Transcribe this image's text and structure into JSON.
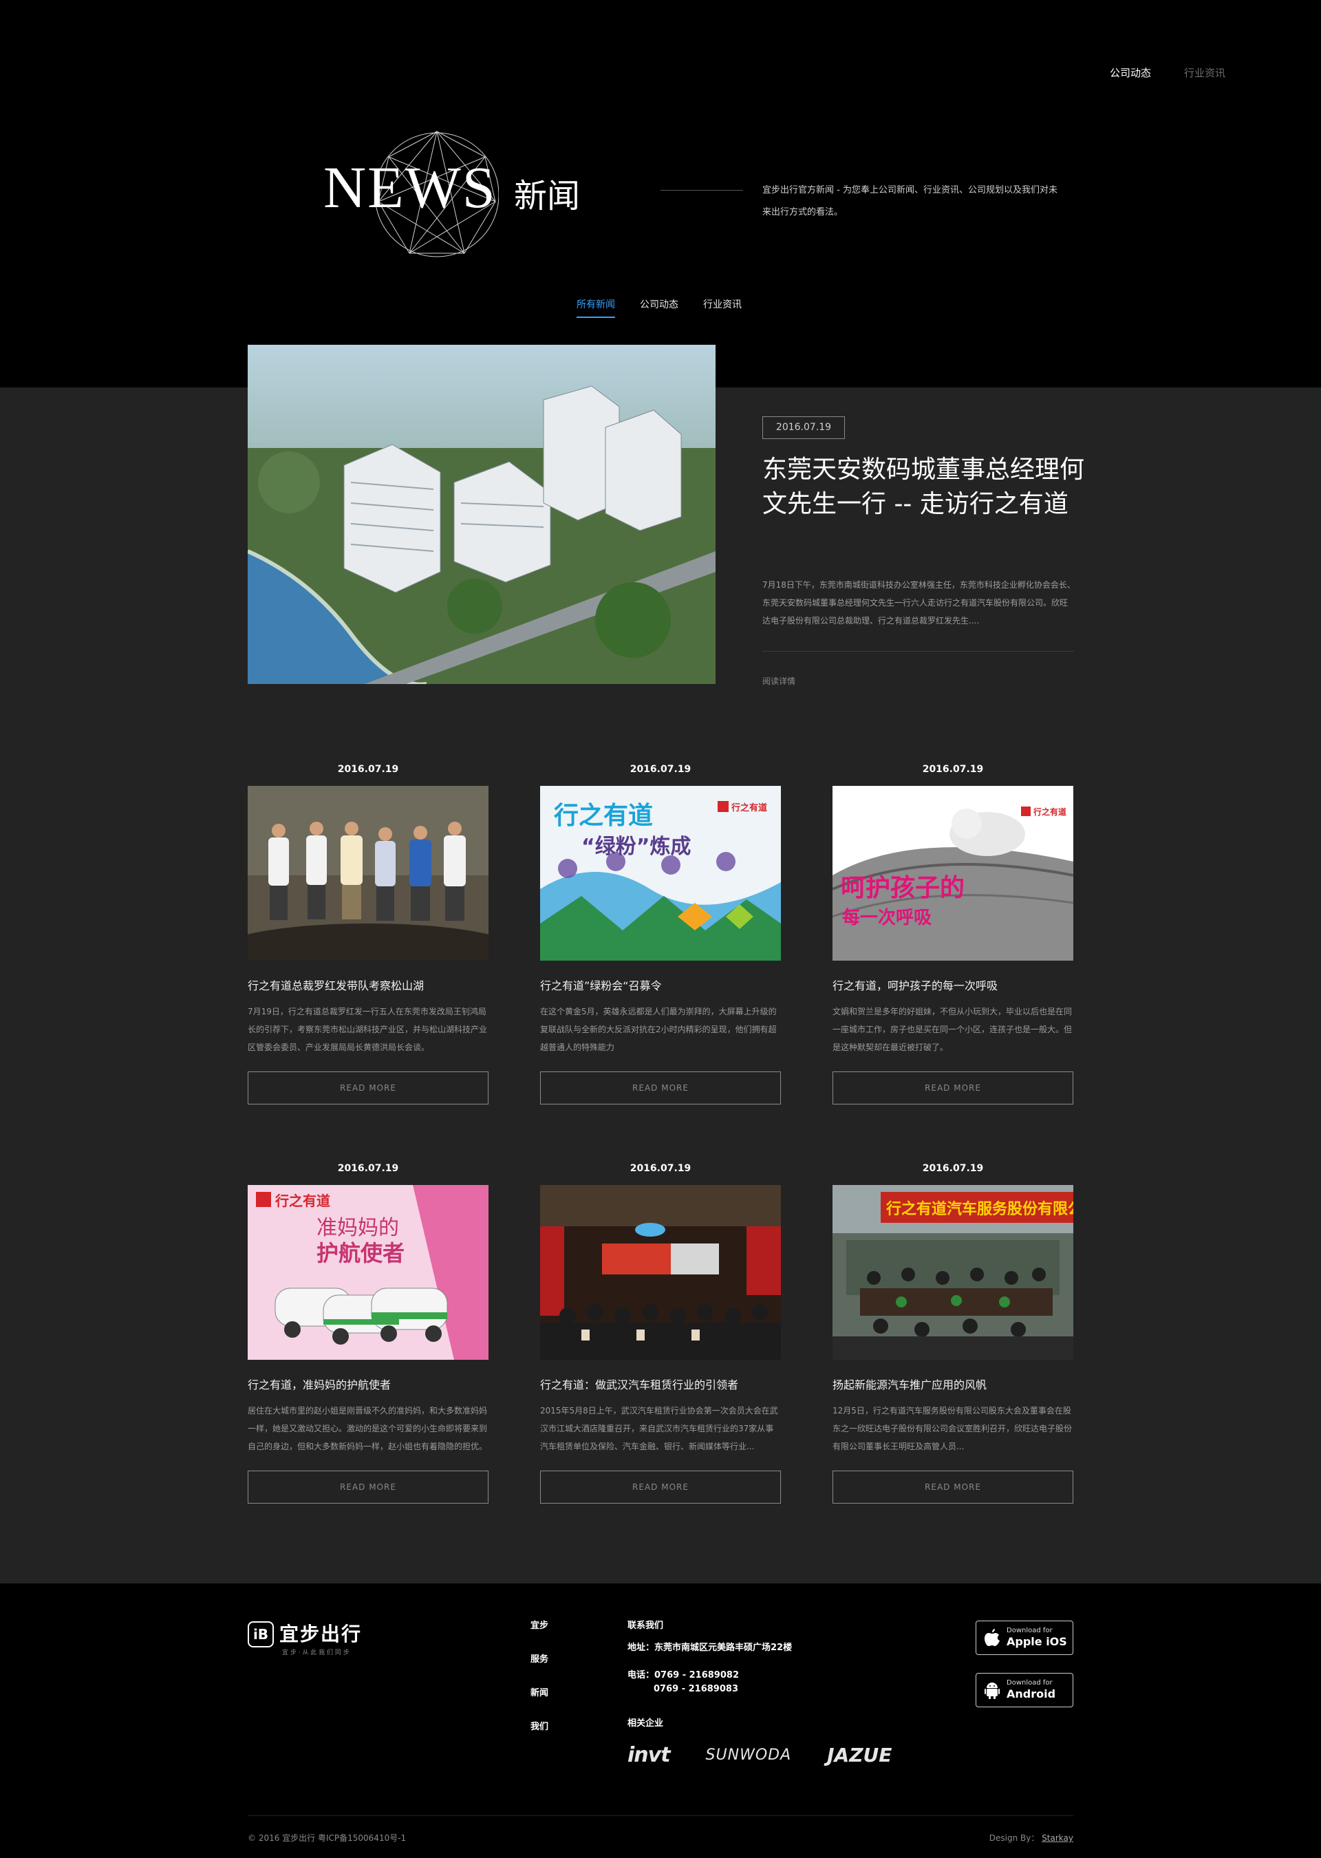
{
  "header": {
    "nav": [
      "公司动态",
      "行业资讯"
    ],
    "logo_word": "NEWS",
    "logo_cn": "新闻",
    "description": "宜步出行官方新闻 - 为您奉上公司新闻、行业资讯、公司规划以及我们对未来出行方式的看法。"
  },
  "tabs": [
    "所有新闻",
    "公司动态",
    "行业资讯"
  ],
  "featured": {
    "date": "2016.07.19",
    "title": "东莞天安数码城董事总经理何文先生一行 -- 走访行之有道",
    "excerpt": "7月18日下午，东莞市南城街道科技办公室林强主任，东莞市科技企业孵化协会会长、东莞天安数码城董事总经理何文先生一行六人走访行之有道汽车股份有限公司。欣旺达电子股份有限公司总裁助理、行之有道总裁罗红发先生....",
    "read_more": "阅读详情"
  },
  "cards": [
    {
      "date": "2016.07.19",
      "title": "行之有道总裁罗红发带队考察松山湖",
      "excerpt": "7月19日，行之有道总裁罗红发一行五人在东莞市发改局王钊鸿局长的引荐下，考察东莞市松山湖科技产业区，并与松山湖科技产业区管委会委员、产业发展局局长黄德洪局长会谈。",
      "button": "READ MORE",
      "image_text": []
    },
    {
      "date": "2016.07.19",
      "title": "行之有道”绿粉会“召募令",
      "excerpt": "在这个黄金5月，英雄永远都是人们最为崇拜的，大屏幕上升级的复联战队与全新的大反派对抗在2小时内精彩的呈现，他们拥有超越普通人的特殊能力",
      "button": "READ MORE",
      "image_text": [
        "行之有道",
        "“绿粉”炼成",
        "行之有道"
      ]
    },
    {
      "date": "2016.07.19",
      "title": "行之有道，呵护孩子的每一次呼吸",
      "excerpt": "文娟和贺兰是多年的好姐妹，不但从小玩到大，毕业以后也是在同一座城市工作，房子也是买在同一个小区，连孩子也是一般大。但是这种默契却在最近被打破了。",
      "button": "READ MORE",
      "image_text": [
        "呵护孩子的",
        "每一次呼吸",
        "行之有道"
      ]
    },
    {
      "date": "2016.07.19",
      "title": "行之有道，准妈妈的护航使者",
      "excerpt": "居住在大城市里的赵小姐是刚晋级不久的准妈妈，和大多数准妈妈一样，她是又激动又担心。激动的是这个可爱的小生命即将要来到自己的身边，但和大多数新妈妈一样，赵小姐也有着隐隐的担优。",
      "button": "READ MORE",
      "image_text": [
        "行之有道",
        "准妈妈的",
        "护航使者"
      ]
    },
    {
      "date": "2016.07.19",
      "title": "行之有道：做武汉汽车租赁行业的引领者",
      "excerpt": "2015年5月8日上午，武汉汽车租赁行业协会第一次会员大会在武汉市江城大酒店隆重召开，来自武汉市汽车租赁行业的37家从事汽车租赁单位及保险、汽车金融、银行、新闻媒体等行业...",
      "button": "READ MORE",
      "image_text": []
    },
    {
      "date": "2016.07.19",
      "title": "扬起新能源汽车推广应用的风帆",
      "excerpt": "12月5日，行之有道汽车服务股份有限公司股东大会及董事会在股东之一欣旺达电子股份有限公司会议室胜利召开，欣旺达电子股份有限公司董事长王明旺及高管人员...",
      "button": "READ MORE",
      "image_text": [
        "行之有道汽车服务股份有限公"
      ]
    }
  ],
  "footer": {
    "logo_text": "宜步出行",
    "logo_sub": "宜 步 · 从 此 我 们 同 步",
    "nav": [
      "宜步",
      "服务",
      "新闻",
      "我们"
    ],
    "contact_title": "联系我们",
    "address": "地址：东莞市南城区元美路丰硕广场22楼",
    "phone1": "电话：0769 - 21689082",
    "phone2": "0769 - 21689083",
    "related_title": "相关企业",
    "partners": [
      "invt",
      "SUNWODA",
      "JAZUE"
    ],
    "ios_small": "Download for",
    "ios_big": "Apple iOS",
    "android_small": "Download for",
    "android_big": "Android",
    "copyright": "© 2016 宜步出行    粤ICP备15006410号-1",
    "design_label": "Design By：",
    "design_name": "Starkay"
  }
}
